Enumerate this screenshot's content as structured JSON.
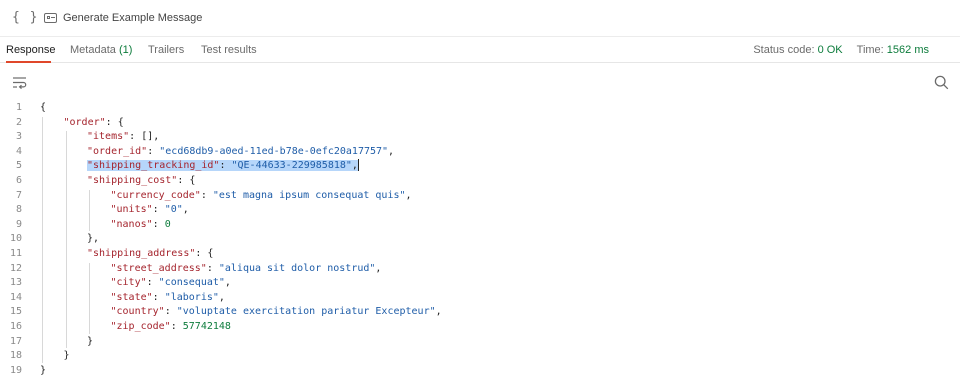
{
  "toolbar": {
    "braces_glyph": "{ }",
    "generate_label": "Generate Example Message"
  },
  "tabs": [
    {
      "label": "Response",
      "active": true
    },
    {
      "label": "Metadata",
      "count": "(1)"
    },
    {
      "label": "Trailers"
    },
    {
      "label": "Test results"
    }
  ],
  "status": {
    "code_label": "Status code:",
    "code_value": "0 OK",
    "time_label": "Time:",
    "time_value": "1562 ms"
  },
  "colors": {
    "key": "#a5252e",
    "string": "#1f5da8",
    "number": "#0d7c3c",
    "highlight": "#b6d6fa",
    "active_tab_underline": "#e0472a"
  },
  "icons": [
    "braces-icon",
    "generate-message-icon",
    "wrap-lines-icon",
    "search-icon"
  ],
  "code_lines": [
    {
      "n": "1",
      "indent": 0,
      "tokens": [
        [
          "p",
          "{"
        ]
      ]
    },
    {
      "n": "2",
      "indent": 1,
      "tokens": [
        [
          "k",
          "\"order\""
        ],
        [
          "p",
          ": {"
        ]
      ]
    },
    {
      "n": "3",
      "indent": 2,
      "tokens": [
        [
          "k",
          "\"items\""
        ],
        [
          "p",
          ": [],"
        ]
      ]
    },
    {
      "n": "4",
      "indent": 2,
      "tokens": [
        [
          "k",
          "\"order_id\""
        ],
        [
          "p",
          ": "
        ],
        [
          "s",
          "\"ecd68db9-a0ed-11ed-b78e-0efc20a17757\""
        ],
        [
          "p",
          ","
        ]
      ]
    },
    {
      "n": "5",
      "indent": 2,
      "highlight": true,
      "tokens": [
        [
          "k",
          "\"shipping_tracking_id\""
        ],
        [
          "p",
          ": "
        ],
        [
          "s",
          "\"QE-44633-229985818\""
        ],
        [
          "p",
          ","
        ]
      ]
    },
    {
      "n": "6",
      "indent": 2,
      "tokens": [
        [
          "k",
          "\"shipping_cost\""
        ],
        [
          "p",
          ": {"
        ]
      ]
    },
    {
      "n": "7",
      "indent": 3,
      "tokens": [
        [
          "k",
          "\"currency_code\""
        ],
        [
          "p",
          ": "
        ],
        [
          "s",
          "\"est magna ipsum consequat quis\""
        ],
        [
          "p",
          ","
        ]
      ]
    },
    {
      "n": "8",
      "indent": 3,
      "tokens": [
        [
          "k",
          "\"units\""
        ],
        [
          "p",
          ": "
        ],
        [
          "s",
          "\"0\""
        ],
        [
          "p",
          ","
        ]
      ]
    },
    {
      "n": "9",
      "indent": 3,
      "tokens": [
        [
          "k",
          "\"nanos\""
        ],
        [
          "p",
          ": "
        ],
        [
          "n",
          "0"
        ]
      ]
    },
    {
      "n": "10",
      "indent": 2,
      "tokens": [
        [
          "p",
          "},"
        ]
      ]
    },
    {
      "n": "11",
      "indent": 2,
      "tokens": [
        [
          "k",
          "\"shipping_address\""
        ],
        [
          "p",
          ": {"
        ]
      ]
    },
    {
      "n": "12",
      "indent": 3,
      "tokens": [
        [
          "k",
          "\"street_address\""
        ],
        [
          "p",
          ": "
        ],
        [
          "s",
          "\"aliqua sit dolor nostrud\""
        ],
        [
          "p",
          ","
        ]
      ]
    },
    {
      "n": "13",
      "indent": 3,
      "tokens": [
        [
          "k",
          "\"city\""
        ],
        [
          "p",
          ": "
        ],
        [
          "s",
          "\"consequat\""
        ],
        [
          "p",
          ","
        ]
      ]
    },
    {
      "n": "14",
      "indent": 3,
      "tokens": [
        [
          "k",
          "\"state\""
        ],
        [
          "p",
          ": "
        ],
        [
          "s",
          "\"laboris\""
        ],
        [
          "p",
          ","
        ]
      ]
    },
    {
      "n": "15",
      "indent": 3,
      "tokens": [
        [
          "k",
          "\"country\""
        ],
        [
          "p",
          ": "
        ],
        [
          "s",
          "\"voluptate exercitation pariatur Excepteur\""
        ],
        [
          "p",
          ","
        ]
      ]
    },
    {
      "n": "16",
      "indent": 3,
      "tokens": [
        [
          "k",
          "\"zip_code\""
        ],
        [
          "p",
          ": "
        ],
        [
          "n",
          "57742148"
        ]
      ]
    },
    {
      "n": "17",
      "indent": 2,
      "tokens": [
        [
          "p",
          "}"
        ]
      ]
    },
    {
      "n": "18",
      "indent": 1,
      "tokens": [
        [
          "p",
          "}"
        ]
      ]
    },
    {
      "n": "19",
      "indent": 0,
      "tokens": [
        [
          "p",
          "}"
        ]
      ]
    }
  ]
}
